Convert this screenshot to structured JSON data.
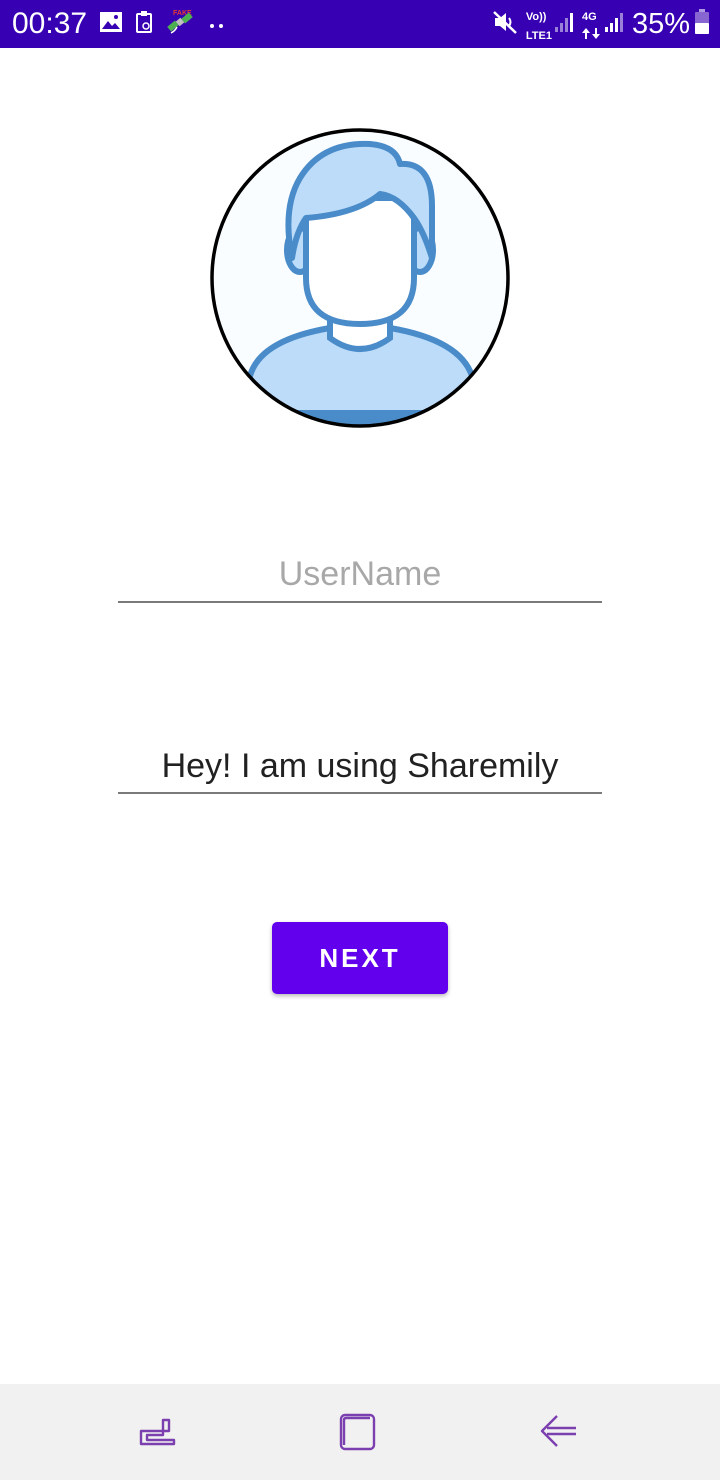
{
  "status_bar": {
    "time": "00:37",
    "left_icons": [
      "image-icon",
      "clipboard-icon",
      "satellite-icon",
      "more-dots-icon"
    ],
    "volte_label": "Vo))",
    "lte_label": "LTE1",
    "network_label": "4G",
    "battery_percent": "35%",
    "background_color": "#3700b3"
  },
  "profile": {
    "avatar_icon": "user-avatar-icon"
  },
  "form": {
    "username_placeholder": "UserName",
    "status_value": "Hey! I am using Sharemily"
  },
  "actions": {
    "next_label": "NEXT",
    "button_color": "#6200ee"
  },
  "nav_bar": {
    "buttons": [
      "recent-apps-icon",
      "home-icon",
      "back-icon"
    ],
    "icon_color": "#7b3fb0"
  }
}
